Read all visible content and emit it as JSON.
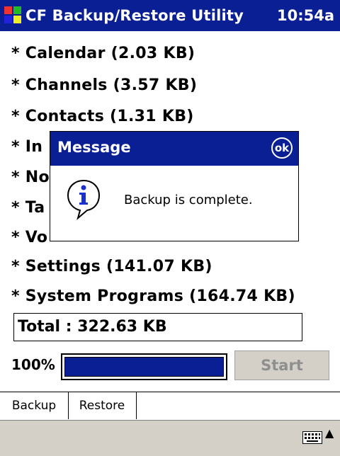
{
  "titlebar": {
    "app_icon": "windows-flag-icon",
    "title": "CF Backup/Restore Utility",
    "time": "10:54a"
  },
  "items": [
    "* Calendar (2.03 KB)",
    "* Channels (3.57 KB)",
    "* Contacts (1.31 KB)",
    "* In",
    "* No",
    "* Ta",
    "* Vo",
    "* Settings (141.07 KB)",
    "* System Programs (164.74 KB)"
  ],
  "total": {
    "text": "Total :  322.63 KB"
  },
  "progress": {
    "percent_label": "100%",
    "fraction": 1.0
  },
  "start_button": {
    "label": "Start"
  },
  "tabs": [
    {
      "label": "Backup"
    },
    {
      "label": "Restore"
    }
  ],
  "bottombar": {
    "keyboard_icon": "keyboard-icon",
    "arrow_icon": "up-arrow-icon",
    "arrow": "▲"
  },
  "dialog": {
    "title": "Message",
    "ok_label": "ok",
    "icon": "info-icon",
    "message": "Backup is complete."
  },
  "colors": {
    "accent": "#0a1f94",
    "disabled_bg": "#d4d0c8"
  }
}
